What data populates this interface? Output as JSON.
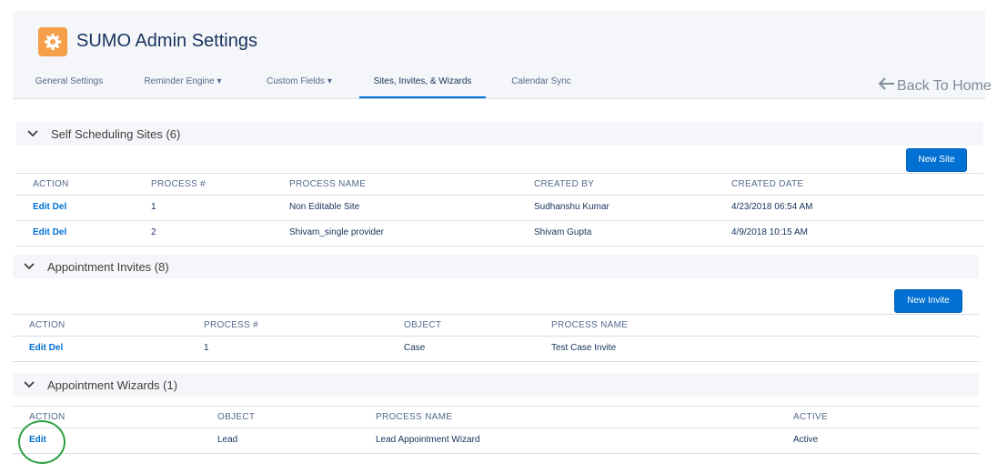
{
  "colors": {
    "brand": "#0070d2",
    "accent": "#f59f4b",
    "annotation": "#2ea043"
  },
  "header": {
    "icon": "gear-icon",
    "title": "SUMO Admin Settings",
    "tabs": [
      {
        "label": "General Settings",
        "dropdown": false
      },
      {
        "label": "Reminder Engine ▾",
        "dropdown": true
      },
      {
        "label": "Custom Fields ▾",
        "dropdown": true
      },
      {
        "label": "Sites, Invites, & Wizards",
        "active": true
      },
      {
        "label": "Calendar Sync",
        "dropdown": false
      }
    ],
    "back_link": "Back To Home"
  },
  "sections": {
    "sites": {
      "title": "Self Scheduling Sites (6)",
      "new_button": "New Site",
      "columns": [
        "ACTION",
        "PROCESS #",
        "PROCESS NAME",
        "CREATED BY",
        "CREATED DATE"
      ],
      "rows": [
        {
          "action": "Edit Del",
          "process_no": "1",
          "process_name": "Non Editable Site",
          "created_by": "Sudhanshu Kumar",
          "created_date": "4/23/2018 06:54 AM"
        },
        {
          "action": "Edit Del",
          "process_no": "2",
          "process_name": "Shivam_single provider",
          "created_by": "Shivam Gupta",
          "created_date": "4/9/2018 10:15 AM"
        }
      ]
    },
    "invites": {
      "title": "Appointment Invites  (8)",
      "new_button": "New Invite",
      "columns": [
        "ACTION",
        "PROCESS #",
        "OBJECT",
        "PROCESS NAME"
      ],
      "rows": [
        {
          "action": "Edit Del",
          "process_no": "1",
          "object": "Case",
          "process_name": "Test Case Invite"
        }
      ]
    },
    "wizards": {
      "title": "Appointment Wizards  (1)",
      "columns": [
        "ACTION",
        "OBJECT",
        "PROCESS NAME",
        "ACTIVE"
      ],
      "rows": [
        {
          "action": "Edit",
          "object": "Lead",
          "process_name": "Lead Appointment Wizard",
          "active": "Active"
        }
      ]
    }
  }
}
